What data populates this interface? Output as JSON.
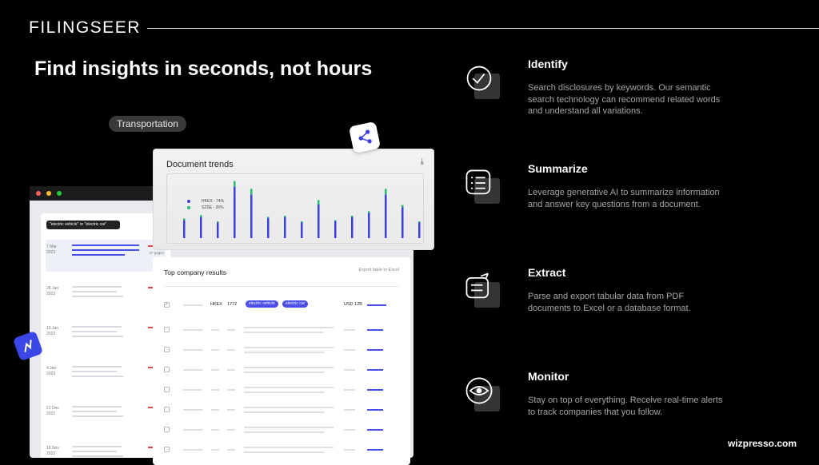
{
  "brand": "FILINGSEER",
  "headline": "Find insights in seconds, not hours",
  "category_chip": "Transportation",
  "mock": {
    "search_query": "\"electric vehicle\" or \"electric car\"",
    "list_rows": [
      {
        "date": "7 Mar 2023",
        "pages": "47 pages"
      },
      {
        "date": "28 Jan 2023",
        "pages": ""
      },
      {
        "date": "13 Jan 2023",
        "pages": ""
      },
      {
        "date": "4 Jan 2023",
        "pages": ""
      },
      {
        "date": "21 Dec 2022",
        "pages": ""
      },
      {
        "date": "18 Nov 2022",
        "pages": ""
      }
    ],
    "chart_title": "Document trends",
    "legend": [
      "HKEX - 74%",
      "SZSE - 26%"
    ],
    "table_title": "Top company results",
    "export_label": "Export table to Excel",
    "first_row": {
      "exchange": "HKEX",
      "code": "1772",
      "tags": [
        "electric vehicle",
        "electric car"
      ],
      "value": "USD 12B"
    }
  },
  "chart_data": {
    "type": "bar",
    "title": "Document trends",
    "series": [
      {
        "name": "HKEX - 74%",
        "color": "#3b3fe0",
        "values": [
          0.32,
          0.38,
          0.28,
          0.92,
          0.78,
          0.36,
          0.38,
          0.28,
          0.6,
          0.3,
          0.38,
          0.45,
          0.78,
          0.55,
          0.28
        ]
      },
      {
        "name": "SZSE - 26%",
        "color": "#1fbf73",
        "values": [
          0.03,
          0.03,
          0.02,
          0.1,
          0.1,
          0.02,
          0.02,
          0.02,
          0.08,
          0.02,
          0.02,
          0.03,
          0.1,
          0.04,
          0.02
        ]
      }
    ]
  },
  "features": [
    {
      "title": "Identify",
      "icon": "search-check-icon",
      "desc": "Search disclosures by keywords. Our semantic search technology can recommend related words and understand all variations."
    },
    {
      "title": "Summarize",
      "icon": "list-icon",
      "desc": "Leverage generative AI to summarize information and answer key questions from a document."
    },
    {
      "title": "Extract",
      "icon": "export-list-icon",
      "desc": "Parse and export tabular data from PDF documents to Excel or a database format."
    },
    {
      "title": "Monitor",
      "icon": "eye-icon",
      "desc": "Stay on top of everything. Receive real-time alerts to track companies that you follow."
    }
  ],
  "footer": "wizpresso.com"
}
